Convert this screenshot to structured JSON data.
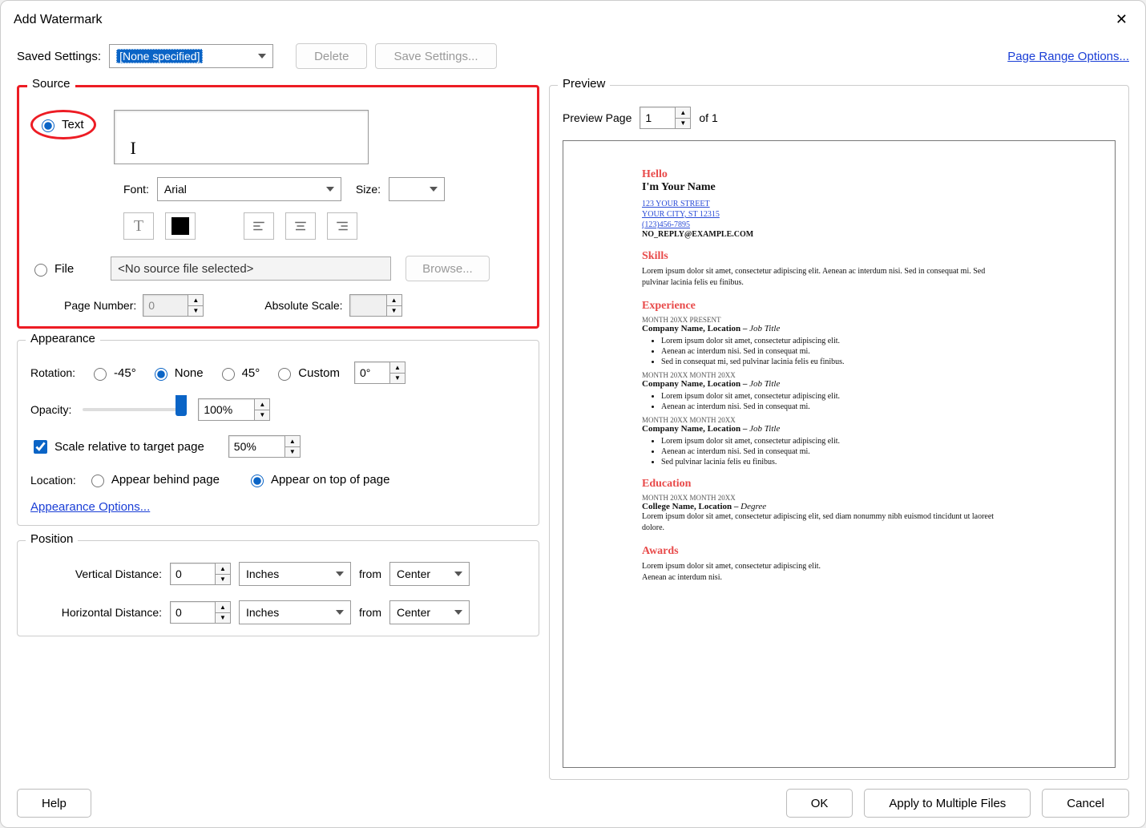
{
  "title": "Add Watermark",
  "savedSettings": {
    "label": "Saved Settings:",
    "value": "[None specified]",
    "deleteLabel": "Delete",
    "saveLabel": "Save Settings..."
  },
  "pageRangeLink": "Page Range Options...",
  "source": {
    "legend": "Source",
    "textRadio": "Text",
    "textValue": "",
    "fontLabel": "Font:",
    "fontValue": "Arial",
    "sizeLabel": "Size:",
    "sizeValue": "",
    "fileRadio": "File",
    "filePlaceholder": "<No source file selected>",
    "browseLabel": "Browse...",
    "pageNumLabel": "Page Number:",
    "pageNumValue": "0",
    "absScaleLabel": "Absolute Scale:",
    "absScaleValue": ""
  },
  "appearance": {
    "legend": "Appearance",
    "rotationLabel": "Rotation:",
    "rotNeg45": "-45°",
    "rotNone": "None",
    "rot45": "45°",
    "rotCustom": "Custom",
    "rotCustomValue": "0°",
    "opacityLabel": "Opacity:",
    "opacityValue": "100%",
    "scaleCheck": "Scale relative to target page",
    "scaleValue": "50%",
    "locationLabel": "Location:",
    "locBehind": "Appear behind page",
    "locTop": "Appear on top of page",
    "optionsLink": "Appearance Options..."
  },
  "position": {
    "legend": "Position",
    "vertLabel": "Vertical Distance:",
    "vertValue": "0",
    "vertUnit": "Inches",
    "fromLabel": "from",
    "vertFrom": "Center",
    "horizLabel": "Horizontal Distance:",
    "horizValue": "0",
    "horizUnit": "Inches",
    "horizFrom": "Center"
  },
  "preview": {
    "legend": "Preview",
    "pageLabel": "Preview Page",
    "pageValue": "1",
    "ofLabel": "of 1",
    "doc": {
      "hello": "Hello",
      "name": "I'm Your Name",
      "addr1": "123 YOUR STREET",
      "addr2": "YOUR CITY, ST 12315",
      "phone": "(123)456-7895",
      "email": "NO_REPLY@EXAMPLE.COM",
      "skills": "Skills",
      "skillsBody": "Lorem ipsum dolor sit amet, consectetur adipiscing elit. Aenean ac interdum nisi. Sed in consequat mi. Sed pulvinar lacinia felis eu finibus.",
      "experience": "Experience",
      "exp1date": "MONTH 20XX   PRESENT",
      "exp1title": "Company Name, Location",
      "exp1role": "Job Title",
      "exp2date": "MONTH 20XX   MONTH 20XX",
      "exp3date": "MONTH 20XX   MONTH 20XX",
      "b1": "Lorem ipsum dolor sit amet, consectetur adipiscing elit.",
      "b2": "Aenean ac interdum nisi. Sed in consequat mi.",
      "b3": "Sed in consequat mi, sed pulvinar lacinia felis eu finibus.",
      "b4": "Sed pulvinar lacinia felis eu finibus.",
      "education": "Education",
      "edudate": "MONTH 20XX   MONTH 20XX",
      "edutitle": "College Name, Location",
      "edudeg": "Degree",
      "edubody": "Lorem ipsum dolor sit amet, consectetur adipiscing elit, sed diam nonummy nibh euismod tincidunt ut laoreet dolore.",
      "awards": "Awards",
      "awbody1": "Lorem ipsum dolor sit amet, consectetur adipiscing elit.",
      "awbody2": "Aenean ac interdum nisi."
    }
  },
  "buttons": {
    "help": "Help",
    "ok": "OK",
    "apply": "Apply to Multiple Files",
    "cancel": "Cancel"
  }
}
